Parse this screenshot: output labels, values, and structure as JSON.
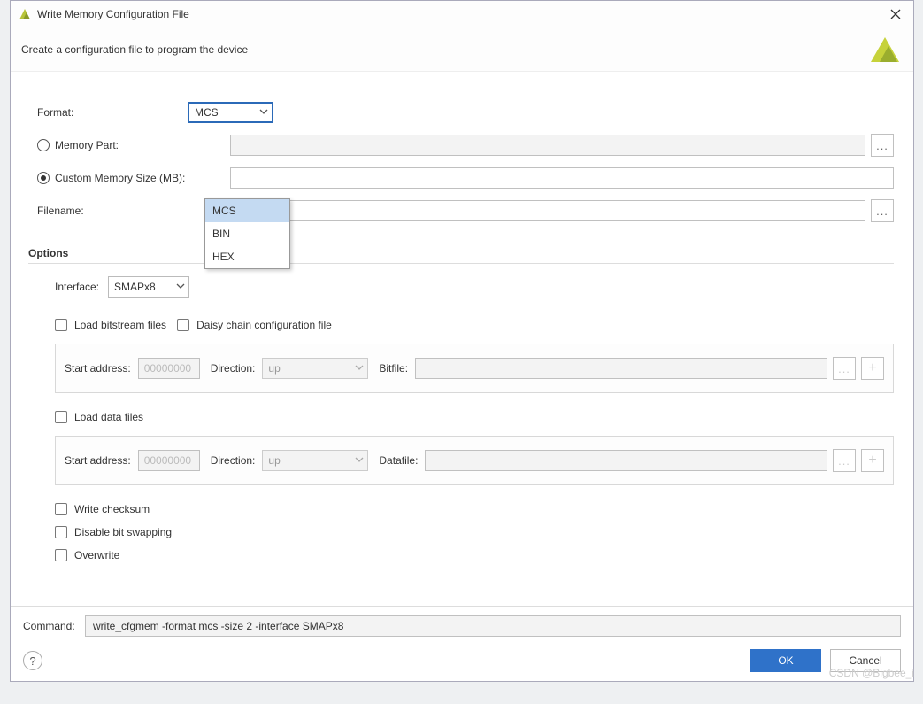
{
  "window": {
    "title": "Write Memory Configuration File",
    "description": "Create a configuration file to program the device"
  },
  "labels": {
    "format": "Format:",
    "memory_part": "Memory Part:",
    "memory_size": "Custom Memory Size (MB):",
    "filename": "Filename:",
    "options": "Options",
    "interface": "Interface:",
    "load_bitstream": "Load bitstream files",
    "daisy_chain": "Daisy chain configuration file",
    "start_address": "Start address:",
    "direction": "Direction:",
    "bitfile": "Bitfile:",
    "load_data": "Load data files",
    "datafile": "Datafile:",
    "write_checksum": "Write checksum",
    "disable_swap": "Disable bit swapping",
    "overwrite": "Overwrite",
    "command": "Command:"
  },
  "values": {
    "format_selected": "MCS",
    "format_options": [
      "MCS",
      "BIN",
      "HEX"
    ],
    "interface_selected": "SMAPx8",
    "start_address_placeholder": "00000000",
    "direction_value": "up",
    "command_value": "write_cfgmem  -format mcs -size 2 -interface SMAPx8"
  },
  "buttons": {
    "ok": "OK",
    "cancel": "Cancel",
    "help": "?",
    "dots": "...",
    "plus": "+",
    "close": "×"
  },
  "watermark": "CSDN @Bigbee_i"
}
